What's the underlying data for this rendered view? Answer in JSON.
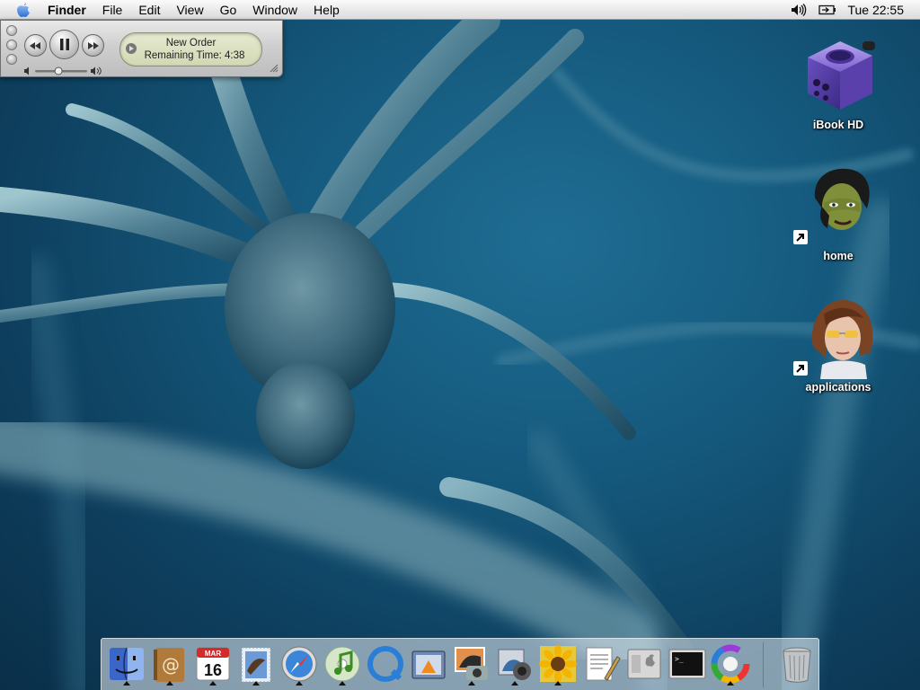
{
  "menubar": {
    "app_name": "Finder",
    "menus": [
      "File",
      "Edit",
      "View",
      "Go",
      "Window",
      "Help"
    ],
    "clock": "Tue 22:55",
    "status_icons": [
      "volume-icon",
      "battery-icon"
    ]
  },
  "player": {
    "track": "New Order",
    "remaining": "Remaining Time: 4:38",
    "controls": [
      "rewind-icon",
      "pause-icon",
      "fast-forward-icon"
    ],
    "volume_level": 0.45
  },
  "desktop": {
    "icons": [
      {
        "label": "iBook HD",
        "icon": "gamecube-drive-icon"
      },
      {
        "label": "home",
        "icon": "woman-green-face-icon"
      },
      {
        "label": "applications",
        "icon": "woman-sunglasses-icon"
      }
    ]
  },
  "dock": {
    "items": [
      {
        "name": "finder",
        "running": true
      },
      {
        "name": "address-book",
        "running": true
      },
      {
        "name": "ical",
        "running": true,
        "date": "16",
        "month": "MAR"
      },
      {
        "name": "mail",
        "running": true
      },
      {
        "name": "safari",
        "running": true
      },
      {
        "name": "itunes",
        "running": true
      },
      {
        "name": "quicktime",
        "running": false
      },
      {
        "name": "preview",
        "running": false
      },
      {
        "name": "iphoto",
        "running": true
      },
      {
        "name": "image-capture",
        "running": true
      },
      {
        "name": "sunflower-app",
        "running": true
      },
      {
        "name": "textedit",
        "running": false
      },
      {
        "name": "system-profiler",
        "running": false
      },
      {
        "name": "terminal",
        "running": false
      },
      {
        "name": "color-app",
        "running": true
      },
      {
        "name": "trash",
        "running": false
      }
    ]
  },
  "colors": {
    "desktop_bg": "#155a7e",
    "lcd_bg": "#dfe3c5"
  }
}
